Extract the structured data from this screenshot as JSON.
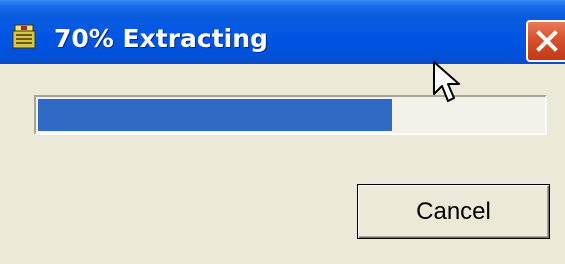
{
  "window": {
    "title": "70% Extracting",
    "app_icon": "archive-extract-icon",
    "close_icon": "close-icon"
  },
  "progress": {
    "percent": 70,
    "fill_color": "#316AC5"
  },
  "buttons": {
    "cancel_label": "Cancel"
  },
  "colors": {
    "titlebar": "#0054E3",
    "close_button": "#D8502C",
    "dialog_background": "#ECE9D8"
  }
}
